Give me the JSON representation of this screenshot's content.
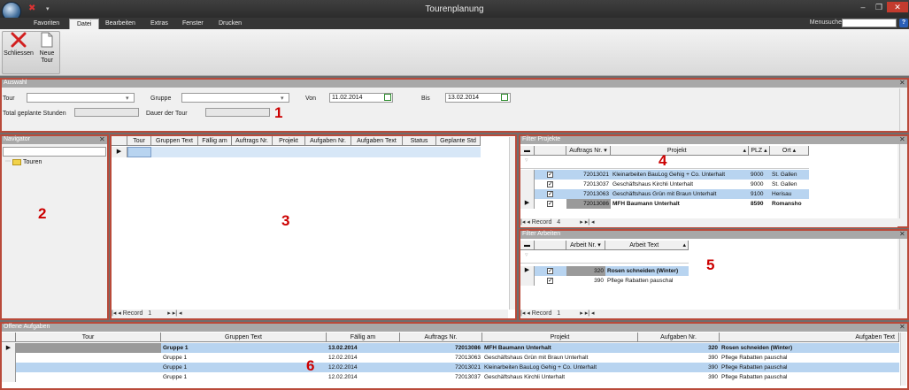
{
  "window": {
    "title": "Tourenplanung"
  },
  "menu": {
    "tabs": [
      "Favoriten",
      "Datei",
      "Bearbeiten",
      "Extras",
      "Fenster",
      "Drucken"
    ],
    "search_label": "Menusuche"
  },
  "ribbon": {
    "buttons": [
      {
        "label": "Schliessen",
        "icon": "red-x-icon"
      },
      {
        "label": "Neue Tour",
        "icon": "new-document-icon"
      }
    ]
  },
  "auswahl": {
    "title": "Auswahl",
    "tour_label": "Tour",
    "gruppe_label": "Gruppe",
    "von_label": "Von",
    "von_value": "11.02.2014",
    "bis_label": "Bis",
    "bis_value": "13.02.2014",
    "total_label": "Total geplante Stunden",
    "dauer_label": "Dauer der Tour"
  },
  "navigator": {
    "title": "Navigator",
    "items": [
      "Touren"
    ]
  },
  "tour_grid": {
    "columns": [
      "Tour",
      "Gruppen Text",
      "Fällig am",
      "Auftrags Nr.",
      "Projekt",
      "Aufgaben Nr.",
      "Aufgaben Text",
      "Status",
      "Geplante Std"
    ],
    "pager_label": "Record",
    "pager_value": "1"
  },
  "filter_projekte": {
    "title": "Filter Projekte",
    "columns": [
      "Auftrags Nr.",
      "Projekt",
      "PLZ",
      "Ort"
    ],
    "rows": [
      {
        "nr": "72013021",
        "projekt": "Kleinarbeiten BauLog Gehig + Co. Unterhalt",
        "plz": "9000",
        "ort": "St. Gallen",
        "checked": "✓"
      },
      {
        "nr": "72013037",
        "projekt": "Geschäftshaus Kirchli Unterhalt",
        "plz": "9000",
        "ort": "St. Gallen",
        "checked": "✓"
      },
      {
        "nr": "72013063",
        "projekt": "Geschäftshaus Grün mit Braun Unterhalt",
        "plz": "9100",
        "ort": "Herisau",
        "checked": "✓"
      },
      {
        "nr": "72013086",
        "projekt": "MFH Baumann Unterhalt",
        "plz": "8590",
        "ort": "Romansho",
        "checked": "✓"
      }
    ],
    "pager_label": "Record",
    "pager_value": "4"
  },
  "filter_arbeiten": {
    "title": "Filter Arbeiten",
    "columns": [
      "Arbeit Nr.",
      "Arbeit Text"
    ],
    "rows": [
      {
        "nr": "320",
        "text": "Rosen schneiden (Winter)",
        "checked": "✓"
      },
      {
        "nr": "390",
        "text": "Pflege Rabatten pauschal",
        "checked": "✓"
      }
    ],
    "pager_label": "Record",
    "pager_value": "1"
  },
  "offene_aufgaben": {
    "title": "Offene Aufgaben",
    "columns": [
      "Tour",
      "Gruppen Text",
      "Fällig am",
      "Auftrags Nr.",
      "Projekt",
      "Aufgaben Nr.",
      "Aufgaben Text"
    ],
    "rows": [
      {
        "gruppe": "Gruppe 1",
        "faellig": "13.02.2014",
        "nr": "72013086",
        "projekt": "MFH Baumann Unterhalt",
        "aufg_nr": "320",
        "aufg_text": "Rosen schneiden (Winter)"
      },
      {
        "gruppe": "Gruppe 1",
        "faellig": "12.02.2014",
        "nr": "72013063",
        "projekt": "Geschäftshaus Grün mit Braun Unterhalt",
        "aufg_nr": "390",
        "aufg_text": "Pflege Rabatten pauschal"
      },
      {
        "gruppe": "Gruppe 1",
        "faellig": "12.02.2014",
        "nr": "72013021",
        "projekt": "Kleinarbeiten BauLog Gehig + Co. Unterhalt",
        "aufg_nr": "390",
        "aufg_text": "Pflege Rabatten pauschal"
      },
      {
        "gruppe": "Gruppe 1",
        "faellig": "12.02.2014",
        "nr": "72013037",
        "projekt": "Geschäftshaus Kirchli Unterhalt",
        "aufg_nr": "390",
        "aufg_text": "Pflege Rabatten pauschal"
      }
    ]
  },
  "annotations": [
    "1",
    "2",
    "3",
    "4",
    "5",
    "6"
  ]
}
